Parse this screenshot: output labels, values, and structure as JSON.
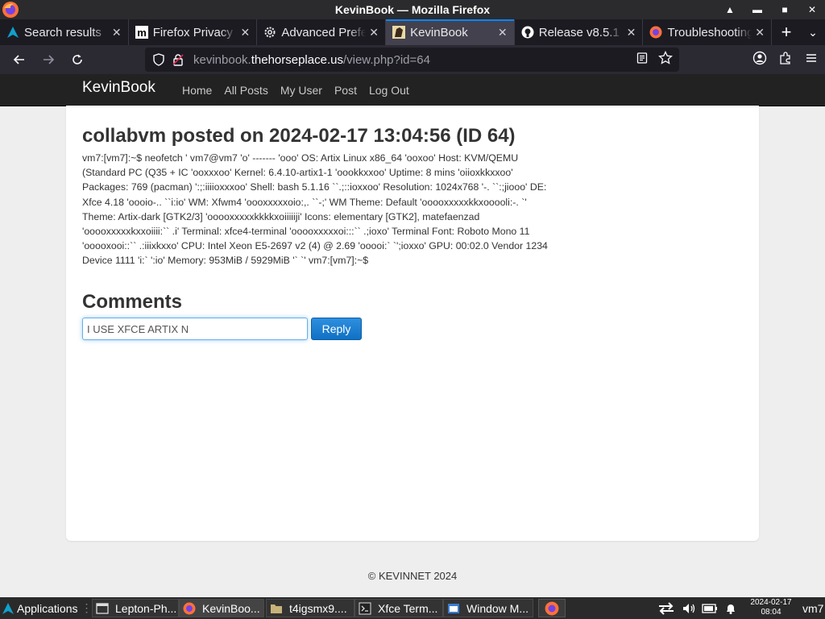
{
  "window": {
    "title": "KevinBook — Mozilla Firefox"
  },
  "tabs": [
    {
      "label": "Search results",
      "icon": "artix-logo-icon",
      "active": false
    },
    {
      "label": "Firefox Privacy",
      "icon": "mozilla-m-icon",
      "active": false
    },
    {
      "label": "Advanced Prefe",
      "icon": "gear-icon",
      "active": false
    },
    {
      "label": "KevinBook",
      "icon": "site-favicon",
      "active": true
    },
    {
      "label": "Release v8.5.1",
      "icon": "github-icon",
      "active": false
    },
    {
      "label": "Troubleshooting",
      "icon": "firefox-icon",
      "active": false
    }
  ],
  "urlbar": {
    "prefix": "kevinbook.",
    "domain": "thehorseplace.us",
    "path": "/view.php?id=64"
  },
  "site": {
    "brand": "KevinBook",
    "nav": [
      "Home",
      "All Posts",
      "My User",
      "Post",
      "Log Out"
    ]
  },
  "post": {
    "title": "collabvm posted on 2024-02-17 13:04:56 (ID 64)",
    "body": "vm7:[vm7]:~$ neofetch ' vm7@vm7 'o' ------- 'ooo' OS: Artix Linux x86_64 'ooxoo' Host: KVM/QEMU (Standard PC (Q35 + IC 'ooxxxoo' Kernel: 6.4.10-artix1-1 'oookkxxoo' Uptime: 8 mins 'oiioxkkxxoo' Packages: 769 (pacman) ':;:iiiioxxxoo' Shell: bash 5.1.16 ``.;::ioxxoo' Resolution: 1024x768 '-. ``:;jiooo' DE: Xfce 4.18 'oooio-.. ``i:io' WM: Xfwm4 'oooxxxxxoio:,. ``-;' WM Theme: Default 'ooooxxxxxkkxooooli:-. `' Theme: Artix-dark [GTK2/3] 'ooooxxxxxkkkkxoiiiiiji' Icons: elementary [GTK2], matefaenzad 'ooooxxxxxkxxoiiii:`` .i' Terminal: xfce4-terminal 'ooooxxxxxoi:::`` .;ioxo' Terminal Font: Roboto Mono 11 'ooooxooi::`` .:iiixkxxo' CPU: Intel Xeon E5-2697 v2 (4) @ 2.69 'ooooi:` `';ioxxo' GPU: 00:02.0 Vendor 1234 Device 1111 'i:` ':io' Memory: 953MiB / 5929MiB '` `' vm7:[vm7]:~$"
  },
  "comments": {
    "heading": "Comments",
    "input_value": "I USE XFCE ARTIX N",
    "reply_label": "Reply"
  },
  "footer": {
    "text": "© KEVINNET 2024"
  },
  "taskbar": {
    "applications_label": "Applications",
    "tasks": [
      {
        "label": "Lepton-Ph...",
        "icon": "window-icon"
      },
      {
        "label": "KevinBoo...",
        "icon": "firefox-icon"
      },
      {
        "label": "t4igsmx9....",
        "icon": "folder-icon"
      },
      {
        "label": "Xfce Term...",
        "icon": "terminal-icon"
      },
      {
        "label": "Window M...",
        "icon": "window-manager-icon"
      }
    ],
    "clock_date": "2024-02-17",
    "clock_time": "08:04",
    "user": "vm7"
  },
  "colors": {
    "accent": "#0a84ff",
    "site_header": "#222222",
    "reply_button": "#1a7fd4"
  }
}
